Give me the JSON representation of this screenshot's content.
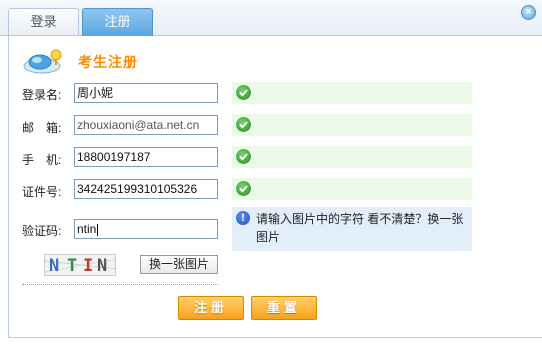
{
  "tabs": [
    {
      "label": "登录"
    },
    {
      "label": "注册"
    }
  ],
  "close_label": "×",
  "heading": "考生注册",
  "form": {
    "username": {
      "label": "登录名:",
      "value": "周小妮"
    },
    "email": {
      "label": "邮　箱:",
      "value": "zhouxiaoni@ata.net.cn"
    },
    "phone": {
      "label": "手　机:",
      "value": "18800197187"
    },
    "id_number": {
      "label": "证件号:",
      "value": "342425199310105326"
    },
    "captcha": {
      "label": "验证码:",
      "value": "ntin"
    }
  },
  "captcha_chars": [
    "N",
    "T",
    "I",
    "N"
  ],
  "captcha_hint": "请输入图片中的字符 看不清楚？换一张图片",
  "refresh_button": "换一张图片",
  "buttons": {
    "submit": "注册",
    "reset": "重置"
  },
  "colors": {
    "accent_orange": "#ff8a00",
    "tab_active": "#5aa6df",
    "ok_bg": "#eafae6",
    "hint_bg": "#e3eefb"
  },
  "icons": {
    "validation": "check-circle-icon",
    "hint": "info-icon",
    "logo": "user-card-icon",
    "close": "close-icon"
  }
}
